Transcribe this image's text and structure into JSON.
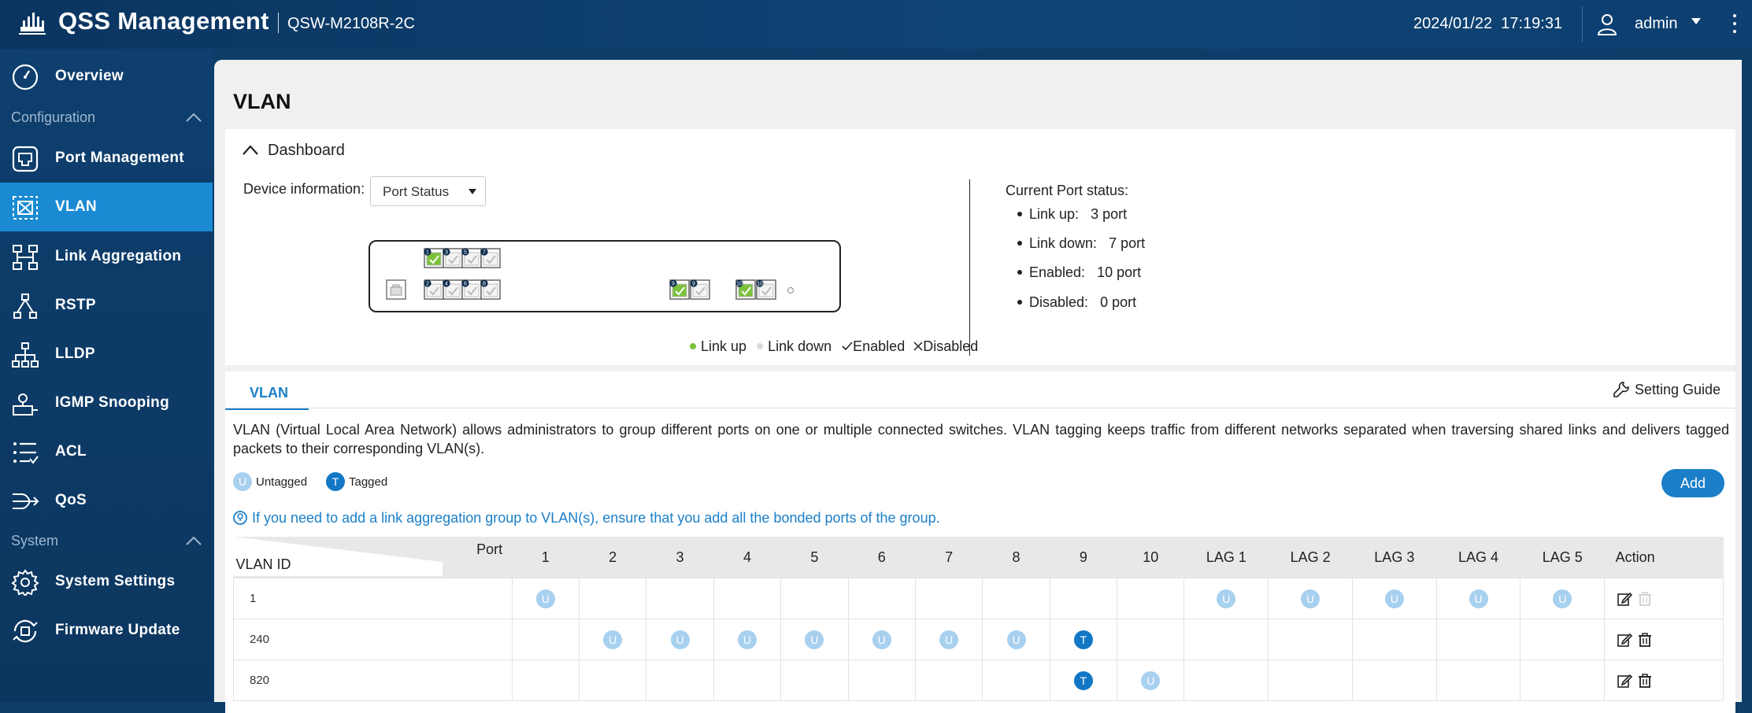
{
  "header": {
    "app_title": "QSS Management",
    "model": "QSW-M2108R-2C",
    "datetime": "2024/01/22  17:19:31",
    "user": "admin"
  },
  "sidebar": {
    "items": [
      {
        "label": "Overview",
        "icon": "gauge-icon"
      },
      {
        "label": "Port Management",
        "icon": "port-icon"
      },
      {
        "label": "VLAN",
        "icon": "vlan-icon",
        "active": true
      },
      {
        "label": "Link Aggregation",
        "icon": "link-aggregation-icon"
      },
      {
        "label": "RSTP",
        "icon": "rstp-icon"
      },
      {
        "label": "LLDP",
        "icon": "lldp-icon"
      },
      {
        "label": "IGMP Snooping",
        "icon": "igmp-icon"
      },
      {
        "label": "ACL",
        "icon": "acl-icon"
      },
      {
        "label": "QoS",
        "icon": "qos-icon"
      },
      {
        "label": "System Settings",
        "icon": "gear-icon"
      },
      {
        "label": "Firmware Update",
        "icon": "firmware-icon"
      }
    ],
    "sections": {
      "configuration": "Configuration",
      "system": "System"
    }
  },
  "page": {
    "title": "VLAN"
  },
  "dashboard": {
    "title": "Dashboard",
    "device_info_label": "Device information:",
    "device_select_value": "Port Status",
    "legend": {
      "link_up": "Link up",
      "link_down": "Link down",
      "enabled": "Enabled",
      "disabled": "Disabled"
    },
    "status_title": "Current Port status:",
    "status": {
      "link_up_label": "Link up:",
      "link_up_value": "3 port",
      "link_down_label": "Link down:",
      "link_down_value": "7 port",
      "enabled_label": "Enabled:",
      "enabled_value": "10 port",
      "disabled_label": "Disabled:",
      "disabled_value": "0 port"
    },
    "ports": [
      {
        "num": "1",
        "link": "up"
      },
      {
        "num": "2",
        "link": "down"
      },
      {
        "num": "3",
        "link": "down"
      },
      {
        "num": "4",
        "link": "down"
      },
      {
        "num": "5",
        "link": "down"
      },
      {
        "num": "6",
        "link": "down"
      },
      {
        "num": "7",
        "link": "down"
      },
      {
        "num": "8",
        "link": "down"
      },
      {
        "num": "9",
        "link": "up"
      },
      {
        "num": "9",
        "link": "down"
      },
      {
        "num": "10",
        "link": "up"
      },
      {
        "num": "10",
        "link": "down"
      }
    ],
    "colors": {
      "link_up": "#7cc13b",
      "link_down": "#d9d9d9",
      "port_label": "#0e2d4d"
    }
  },
  "vlan_section": {
    "tab": "VLAN",
    "setting_guide": "Setting Guide",
    "description": "VLAN (Virtual Local Area Network) allows administrators to group different ports on one or multiple connected switches. VLAN tagging keeps traffic from different networks separated when traversing shared links and delivers tagged packets to their corresponding VLAN(s).",
    "key": {
      "untagged_letter": "U",
      "untagged": "Untagged",
      "tagged_letter": "T",
      "tagged": "Tagged"
    },
    "add_button": "Add",
    "tip": "If you need to add a link aggregation group to VLAN(s), ensure that you add all the bonded ports of the group.",
    "table": {
      "corner_port": "Port",
      "corner_id": "VLAN ID",
      "columns": [
        "1",
        "2",
        "3",
        "4",
        "5",
        "6",
        "7",
        "8",
        "9",
        "10",
        "LAG 1",
        "LAG 2",
        "LAG 3",
        "LAG 4",
        "LAG 5"
      ],
      "action_header": "Action",
      "rows": [
        {
          "id": "1",
          "cells": [
            "U",
            "",
            "",
            "",
            "",
            "",
            "",
            "",
            "",
            "",
            "U",
            "U",
            "U",
            "U",
            "U"
          ],
          "delete_enabled": false
        },
        {
          "id": "240",
          "cells": [
            "",
            "U",
            "U",
            "U",
            "U",
            "U",
            "U",
            "U",
            "T",
            "",
            "",
            "",
            "",
            "",
            ""
          ],
          "delete_enabled": true
        },
        {
          "id": "820",
          "cells": [
            "",
            "",
            "",
            "",
            "",
            "",
            "",
            "",
            "T",
            "U",
            "",
            "",
            "",
            "",
            ""
          ],
          "delete_enabled": true
        }
      ]
    }
  },
  "colors": {
    "accent": "#1a7fc8",
    "sidebar_bg": "#0e3f6e",
    "active_item": "#1a8ad3",
    "untagged": "#a8d0ef",
    "tagged": "#1277c5"
  }
}
